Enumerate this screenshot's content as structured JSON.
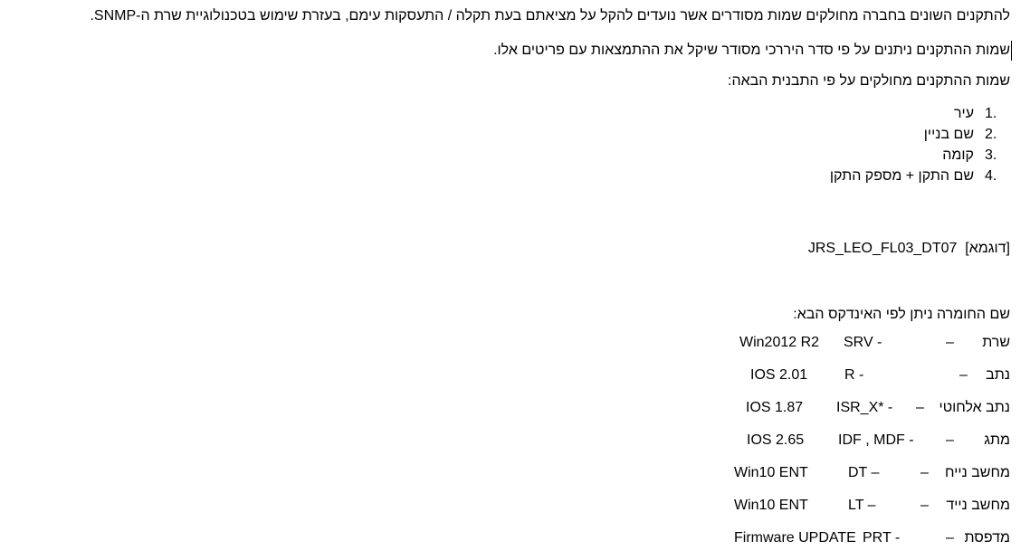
{
  "intro_line_1": "להתקנים השונים בחברה מחולקים שמות מסודרים אשר נועדים להקל על מציאתם בעת תקלה / התעסקות עימם, בעזרת שימוש בטכנולוגיית שרת ה-SNMP.",
  "intro_line_2": "שמות ההתקנים ניתנים על פי סדר היררכי מסודר שיקל את ההתמצאות עם פריטים אלו.",
  "pattern_intro": "שמות ההתקנים מחולקים על פי התבנית הבאה:",
  "pattern_items": [
    {
      "num": "1.",
      "text": "עיר"
    },
    {
      "num": "2.",
      "text": "שם בניין"
    },
    {
      "num": "3.",
      "text": "קומה"
    },
    {
      "num": "4.",
      "text": "שם התקן + מספק התקן"
    }
  ],
  "example_label": "[דוגמא]",
  "example_value": "JRS_LEO_FL03_DT07",
  "index_intro": "שם החומרה ניתן לפי האינדקס הבא:",
  "hardware_index": [
    {
      "name": "שרת",
      "dash": "–",
      "code": "SRV -",
      "version": "Win2012 R2"
    },
    {
      "name": "נתב",
      "dash": "–",
      "code": "R -",
      "version": "IOS 2.01"
    },
    {
      "name": "נתב אלחוטי",
      "dash": "–",
      "code": "ISR_X* -",
      "version": "IOS 1.87"
    },
    {
      "name": "מתג",
      "dash": "–",
      "code": "IDF , MDF -",
      "version": "IOS 2.65"
    },
    {
      "name": "מחשב נייח",
      "dash": "–",
      "code": "DT –",
      "version": "Win10 ENT"
    },
    {
      "name": "מחשב נייד",
      "dash": "–",
      "code": "LT –",
      "version": "Win10 ENT"
    },
    {
      "name": "מדפסת",
      "dash": "–",
      "code": "PRT -",
      "version": "Firmware UPDATE"
    }
  ]
}
